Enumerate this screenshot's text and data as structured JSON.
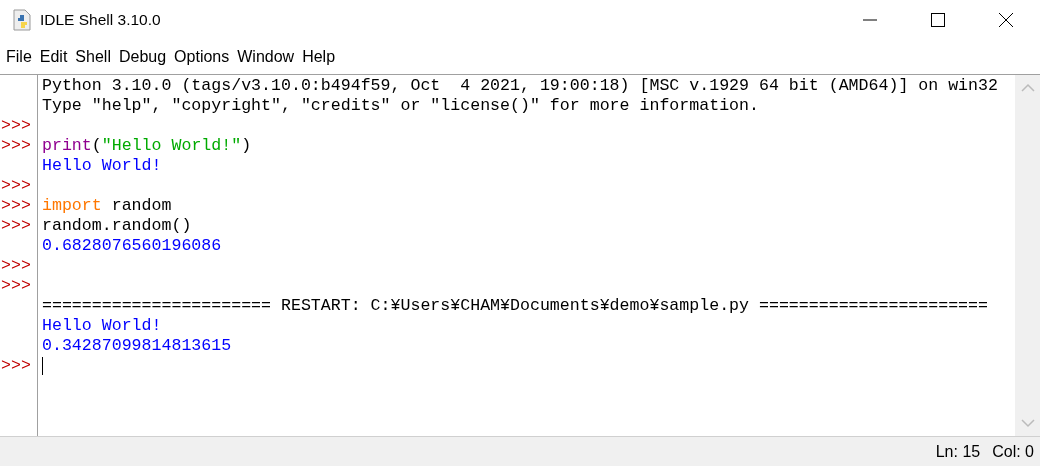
{
  "window": {
    "title": "IDLE Shell 3.10.0"
  },
  "menu": [
    "File",
    "Edit",
    "Shell",
    "Debug",
    "Options",
    "Window",
    "Help"
  ],
  "shell": {
    "lines": [
      {
        "segments": [
          {
            "text": "Python 3.10.0 (tags/v3.10.0:b494f59, Oct  4 2021, 19:00:18) [MSC v.1929 64 bit (AMD64)] on win32",
            "kind": "plain"
          }
        ]
      },
      {
        "segments": [
          {
            "text": "Type \"help\", \"copyright\", \"credits\" or \"license()\" for more information.",
            "kind": "plain"
          }
        ]
      },
      {
        "prompt": ">>>"
      },
      {
        "prompt": ">>>",
        "segments": [
          {
            "text": "print",
            "kind": "builtin"
          },
          {
            "text": "(",
            "kind": "plain"
          },
          {
            "text": "\"Hello World!\"",
            "kind": "string"
          },
          {
            "text": ")",
            "kind": "plain"
          }
        ]
      },
      {
        "segments": [
          {
            "text": "Hello World!",
            "kind": "stdout"
          }
        ]
      },
      {
        "prompt": ">>>"
      },
      {
        "prompt": ">>>",
        "segments": [
          {
            "text": "import",
            "kind": "keyword"
          },
          {
            "text": " random",
            "kind": "plain"
          }
        ]
      },
      {
        "prompt": ">>>",
        "segments": [
          {
            "text": "random.random()",
            "kind": "plain"
          }
        ]
      },
      {
        "segments": [
          {
            "text": "0.6828076560196086",
            "kind": "stdout"
          }
        ]
      },
      {
        "prompt": ">>>"
      },
      {
        "prompt": ">>>"
      },
      {
        "segments": [
          {
            "text": "======================= RESTART: C:¥Users¥CHAM¥Documents¥demo¥sample.py =======================",
            "kind": "plain"
          }
        ]
      },
      {
        "segments": [
          {
            "text": "Hello World!",
            "kind": "stdout"
          }
        ]
      },
      {
        "segments": [
          {
            "text": "0.34287099814813615",
            "kind": "stdout"
          }
        ]
      },
      {
        "prompt": ">>>",
        "cursor": true
      }
    ]
  },
  "status_bar": {
    "line": "Ln: 15",
    "column": "Col: 0"
  }
}
